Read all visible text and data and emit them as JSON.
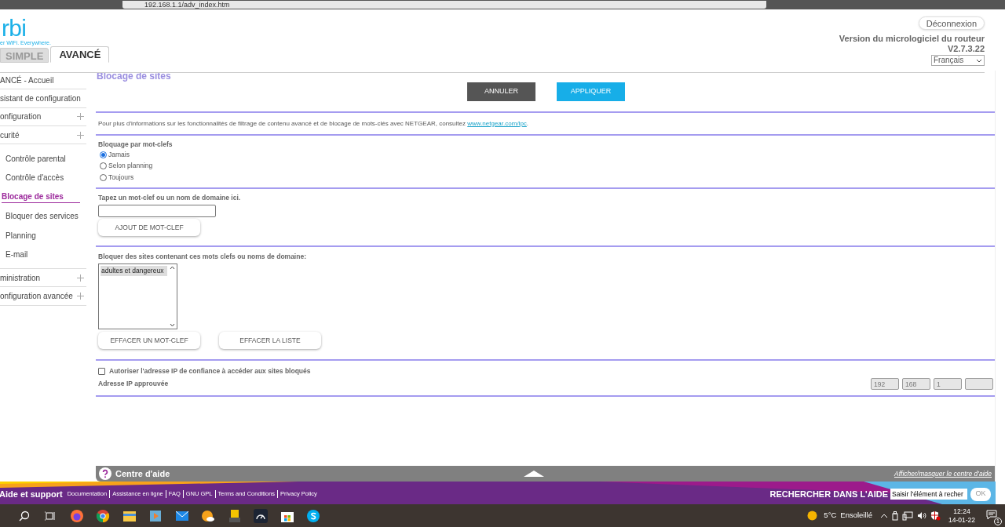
{
  "browser": {
    "url": "192.168.1.1/adv_index.htm"
  },
  "header": {
    "logo": {
      "wordmark": "rbi",
      "tagline": "er WiFi. Everywhere."
    },
    "logout": "Déconnexion",
    "firmware_label": "Version du micrologiciel du routeur",
    "firmware_version": "V2.7.3.22",
    "language": "Français"
  },
  "tabs": [
    {
      "label": "SIMPLE",
      "selected": false
    },
    {
      "label": "AVANCÉ",
      "selected": true
    }
  ],
  "sidebar": {
    "items": [
      {
        "label": "ANCÉ - Accueil",
        "kind": "section",
        "expandable": false,
        "selected": false
      },
      {
        "label": "sistant de configuration",
        "kind": "section",
        "expandable": false,
        "selected": false
      },
      {
        "label": "onfiguration",
        "kind": "section",
        "expandable": true,
        "selected": false
      },
      {
        "label": "curité",
        "kind": "section",
        "expandable": true,
        "selected": false
      },
      {
        "label": "Contrôle parental",
        "kind": "sub",
        "selected": false
      },
      {
        "label": "Contrôle d'accès",
        "kind": "sub",
        "selected": false
      },
      {
        "label": "Blocage de sites",
        "kind": "sub",
        "selected": true
      },
      {
        "label": "Bloquer des services",
        "kind": "sub",
        "selected": false
      },
      {
        "label": "Planning",
        "kind": "sub",
        "selected": false
      },
      {
        "label": "E-mail",
        "kind": "sub",
        "selected": false
      },
      {
        "label": "ministration",
        "kind": "section",
        "expandable": true,
        "selected": false
      },
      {
        "label": "onfiguration avancée",
        "kind": "section",
        "expandable": true,
        "selected": false
      }
    ]
  },
  "page": {
    "title": "Blocage de sites",
    "buttons": [
      {
        "label": "ANNULER",
        "kind": "cancel"
      },
      {
        "label": "APPLIQUER",
        "kind": "apply"
      }
    ],
    "info": {
      "text": "Pour plus d'informations sur les fonctionnalités de filtrage de contenu avancé et de blocage de mots-clés avec NETGEAR, consultez ",
      "link": "www.netgear.com/lpc",
      "suffix": "."
    },
    "keyword_blocking": {
      "label": "Bloquage par mot-clefs",
      "options": [
        {
          "label": "Jamais",
          "selected": true
        },
        {
          "label": "Selon planning",
          "selected": false
        },
        {
          "label": "Toujours",
          "selected": false
        }
      ]
    },
    "keyword_input": {
      "label": "Tapez un mot-clef ou un nom de domaine ici.",
      "add_button": "AJOUT DE MOT-CLEF"
    },
    "blocked_list": {
      "label": "Bloquer des sites contenant ces mots clefs ou noms de domaine:",
      "items": [
        {
          "text": "adultes et dangereux",
          "selected": true
        }
      ],
      "buttons": [
        "EFFACER UN MOT-CLEF",
        "EFFACER LA LISTE"
      ]
    },
    "trusted_ip": {
      "checkbox": {
        "label": "Autoriser l'adresse IP de confiance à accéder aux sites bloqués",
        "checked": false
      },
      "ip_label": "Adresse IP approuvée",
      "ip_fields": [
        {
          "kind": "filled",
          "value": "192"
        },
        {
          "kind": "filled",
          "value": "168"
        },
        {
          "kind": "filled",
          "value": "1"
        },
        {
          "kind": "blank"
        }
      ]
    }
  },
  "help_bar": {
    "title": "Centre d'aide",
    "toggle_link": "Afficher/masquer le centre d'aide"
  },
  "footer": {
    "title": "Aide et support",
    "links": [
      "Documentation",
      "Assistance en ligne",
      "FAQ",
      "GNU GPL",
      "Terms and Conditions",
      "Privacy Policy"
    ],
    "search_label": "RECHERCHER DANS L'AIDE",
    "search_value": "Saisir l'élément à recher",
    "ok_button": "OK"
  },
  "taskbar": {
    "temperature": "5°C",
    "weather": "Ensoleillé",
    "time": "12:24",
    "date": "14-01-22",
    "notifications": "1"
  }
}
